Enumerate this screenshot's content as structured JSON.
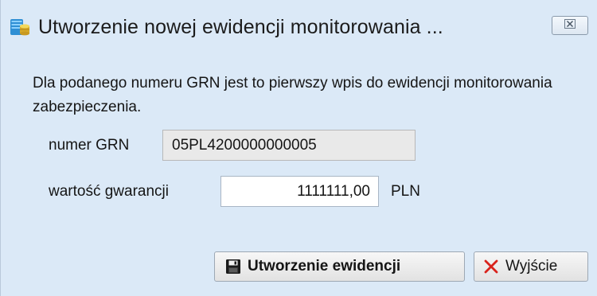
{
  "window": {
    "title": "Utworzenie nowej ewidencji monitorowania ...",
    "icon": "database-icon",
    "close_icon": "close-icon"
  },
  "message": "Dla podanego numeru GRN jest to pierwszy wpis do ewidencji monitorowania zabezpieczenia.",
  "form": {
    "grn_label": "numer GRN",
    "grn_value": "05PL4200000000005",
    "guarantee_label": "wartość gwarancji",
    "guarantee_value": "1111111,00",
    "currency": "PLN"
  },
  "buttons": {
    "create_label": "Utworzenie ewidencji",
    "create_icon": "save-icon",
    "exit_label": "Wyjście",
    "exit_icon": "cross-icon"
  },
  "colors": {
    "background": "#dbe9f7",
    "exit_icon": "#d9231c"
  }
}
